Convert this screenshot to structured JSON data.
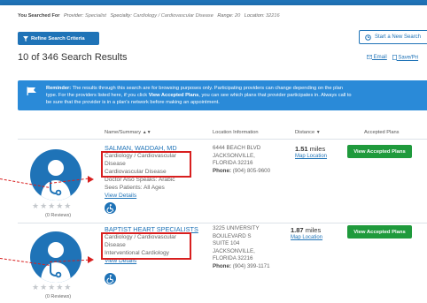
{
  "search_summary": {
    "label": "You Searched For",
    "criteria": [
      {
        "key": "Provider:",
        "value": "Specialist"
      },
      {
        "key": "Specialty:",
        "value": "Cardiology / Cardiovascular Disease"
      },
      {
        "key": "Range:",
        "value": "20"
      },
      {
        "key": "Location:",
        "value": "32216"
      }
    ]
  },
  "toolbar": {
    "refine_label": "Refine Search Criteria",
    "new_search_label": "Start a New Search",
    "email_label": "Email",
    "save_label": "Save/Pri"
  },
  "results": {
    "count_text": "10 of 346 Search Results"
  },
  "banner": {
    "lead": "Reminder:",
    "text1": " The results through this search are for browsing purposes only. Participating providers can change depending on the plan",
    "text2a": "type. For the providers listed here, if you click ",
    "text2b": "View Accepted Plans",
    "text2c": ", you can see which plans that provider participates in. Always call to",
    "text3": "be sure that the provider is in a plan's network before making an appointment."
  },
  "columns": {
    "name": "Name/Summary",
    "location": "Location Information",
    "distance": "Distance",
    "plans": "Accepted Plans"
  },
  "providers": [
    {
      "name": "SALMAN, WADDAH, MD",
      "specialty1": "Cardiology / Cardiovascular",
      "specialty2": "Disease",
      "specialty3": "Cardiovascular Disease",
      "languages": "Doctor Also Speaks: Arabic",
      "ages": "Sees Patients: All Ages",
      "details": "View Details",
      "address1": "6444 BEACH BLVD",
      "address2": "JACKSONVILLE,",
      "address3": "FLORIDA 32216",
      "phone_label": "Phone:",
      "phone": "(904) 805-9600",
      "distance_value": "1.51",
      "distance_unit": "miles",
      "map_link": "Map Location",
      "plans_button": "View Accepted Plans",
      "stars": "★★★★★",
      "reviews": "(0 Reviews)"
    },
    {
      "name": "BAPTIST HEART SPECIALISTS",
      "specialty1": "Cardiology / Cardiovascular",
      "specialty2": "Disease",
      "specialty3": "Interventional Cardiology",
      "details": "View Details",
      "address1": "3225 UNIVERSITY",
      "address2": "BOULEVARD S",
      "address3": "SUITE 104",
      "address4": "JACKSONVILLE,",
      "address5": "FLORIDA 32216",
      "phone_label": "Phone:",
      "phone": "(904) 399-1171",
      "distance_value": "1.87",
      "distance_unit": "miles",
      "map_link": "Map Location",
      "plans_button": "View Accepted Plans",
      "stars": "★★★★★",
      "reviews": "(0 Reviews)"
    }
  ],
  "colors": {
    "primary": "#1f73b7",
    "banner": "#2a8ad8",
    "accept": "#1f9a3c",
    "highlight": "#d81f1f"
  }
}
